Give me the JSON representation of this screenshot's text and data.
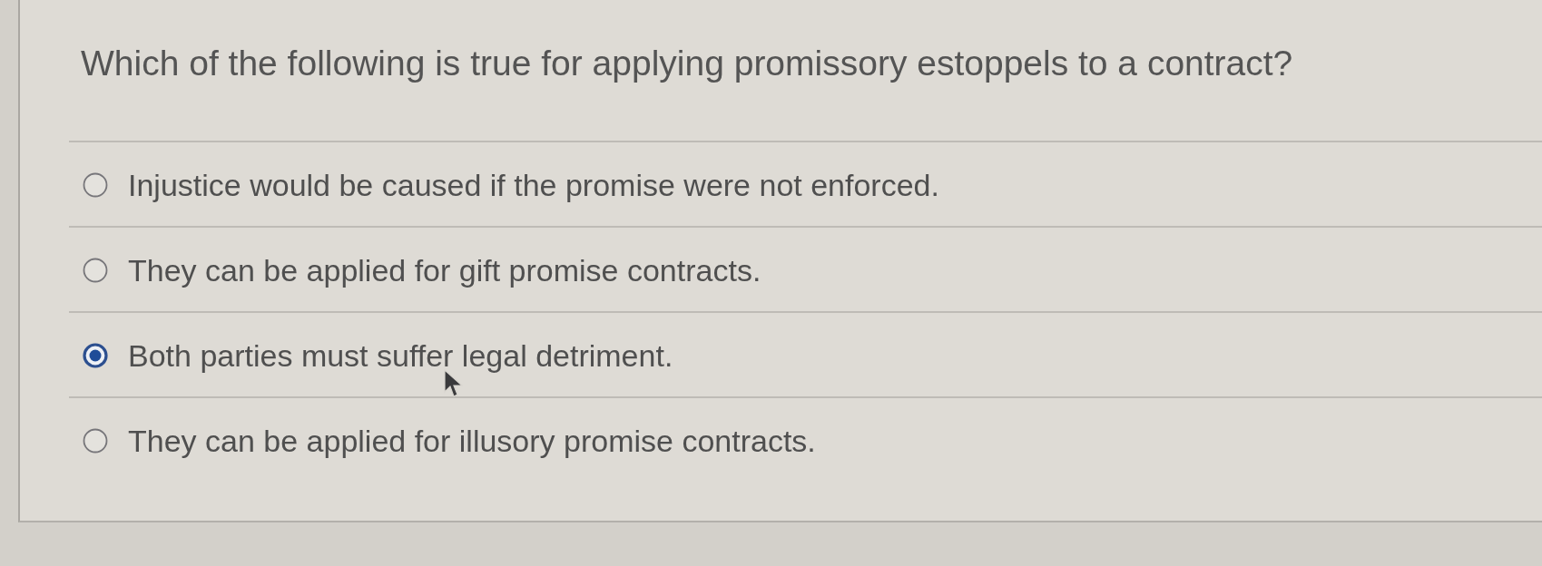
{
  "question": {
    "text": "Which of the following is true for applying promissory estoppels to a contract?"
  },
  "options": [
    {
      "label": "Injustice would be caused if the promise were not enforced.",
      "selected": false
    },
    {
      "label": "They can be applied for gift promise contracts.",
      "selected": false
    },
    {
      "label": "Both parties must suffer legal detriment.",
      "selected": true
    },
    {
      "label": "They can be applied for illusory promise contracts.",
      "selected": false
    }
  ]
}
